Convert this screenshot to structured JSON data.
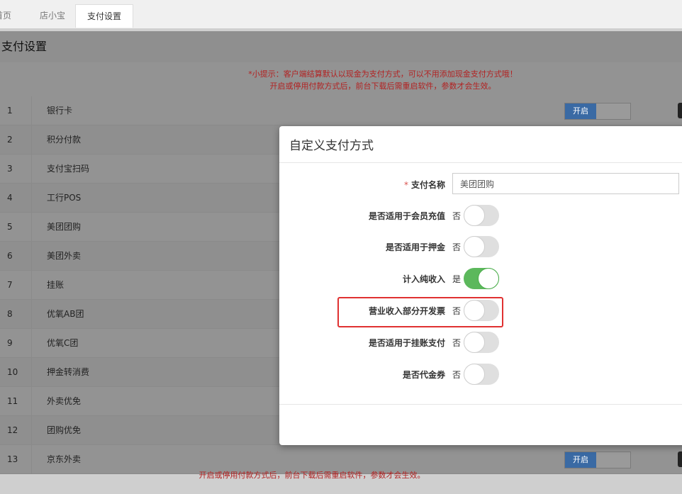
{
  "tabs": [
    {
      "label": "首页",
      "active": false
    },
    {
      "label": "店小宝",
      "active": false
    },
    {
      "label": "支付设置",
      "active": true
    }
  ],
  "panel": {
    "title": "支付设置"
  },
  "notice": {
    "line1": "*小提示：客户端结算默认以现金为支付方式，可以不用添加现金支付方式哦！",
    "line2": "开启或停用付款方式后，前台下载后需重启软件，参数才会生效。"
  },
  "payment_methods": [
    {
      "index": "1",
      "name": "银行卡",
      "status": "开启"
    },
    {
      "index": "2",
      "name": "积分付款"
    },
    {
      "index": "3",
      "name": "支付宝扫码"
    },
    {
      "index": "4",
      "name": "工行POS"
    },
    {
      "index": "5",
      "name": "美团团购"
    },
    {
      "index": "6",
      "name": "美团外卖"
    },
    {
      "index": "7",
      "name": "挂账"
    },
    {
      "index": "8",
      "name": "优氧AB团"
    },
    {
      "index": "9",
      "name": "优氧C团"
    },
    {
      "index": "10",
      "name": "押金转消费"
    },
    {
      "index": "11",
      "name": "外卖优免"
    },
    {
      "index": "12",
      "name": "团购优免"
    },
    {
      "index": "13",
      "name": "京东外卖",
      "status": "开启"
    }
  ],
  "footer_note": "开启或停用付款方式后，前台下载后需重启软件，参数才会生效。",
  "modal": {
    "title": "自定义支付方式",
    "name_field": {
      "required_mark": "*",
      "label": "支付名称",
      "value": "美团团购"
    },
    "toggles": [
      {
        "label": "是否适用于会员充值",
        "state_text": "否",
        "on": false
      },
      {
        "label": "是否适用于押金",
        "state_text": "否",
        "on": false
      },
      {
        "label": "计入纯收入",
        "state_text": "是",
        "on": true
      },
      {
        "label": "营业收入部分开发票",
        "state_text": "否",
        "on": false,
        "highlighted": true
      },
      {
        "label": "是否适用于挂账支付",
        "state_text": "否",
        "on": false
      },
      {
        "label": "是否代金券",
        "state_text": "否",
        "on": false
      }
    ]
  },
  "colors": {
    "toggle_on": "#5cb85c",
    "switch_on": "#3a6aa4",
    "notice_text": "#b22222",
    "highlight": "#e03131"
  }
}
